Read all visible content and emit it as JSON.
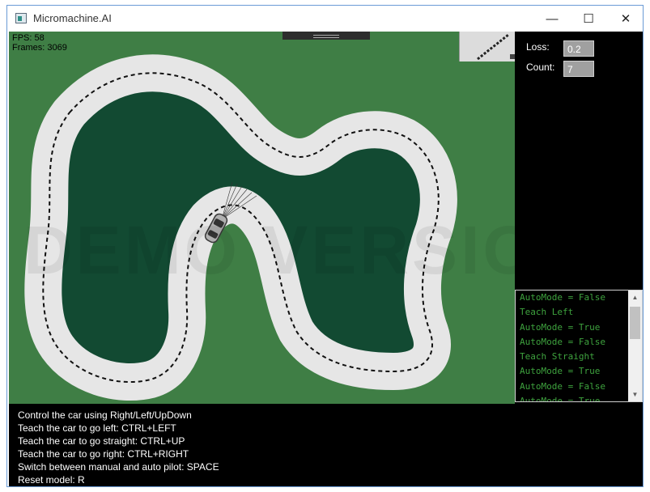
{
  "window": {
    "title": "Micromachine.AI",
    "icon": "app-icon"
  },
  "controls": {
    "minimize": "—",
    "maximize": "☐",
    "close": "✕"
  },
  "stats": {
    "fps": "FPS: 58",
    "frames": "Frames: 3069"
  },
  "watermark": "DEMO VERSION",
  "panel": {
    "loss_label": "Loss:",
    "loss_value": "0.2",
    "count_label": "Count:",
    "count_value": "7"
  },
  "log": {
    "items": [
      "AutoMode = False",
      "Teach Left",
      "AutoMode = True",
      "AutoMode = False",
      "Teach Straight",
      "AutoMode = True",
      "AutoMode = False",
      "AutoMode = True"
    ]
  },
  "help": {
    "lines": [
      "Control the car using Right/Left/UpDown",
      "Teach the car to go left: CTRL+LEFT",
      "Teach the car to go straight: CTRL+UP",
      "Teach the car to go right: CTRL+RIGHT",
      "Switch between manual and auto pilot: SPACE",
      "Reset model: R"
    ]
  },
  "colors": {
    "grass": "#3f7e45",
    "infield": "#124a32",
    "road": "#e6e6e6",
    "log_text": "#3ea23e"
  }
}
